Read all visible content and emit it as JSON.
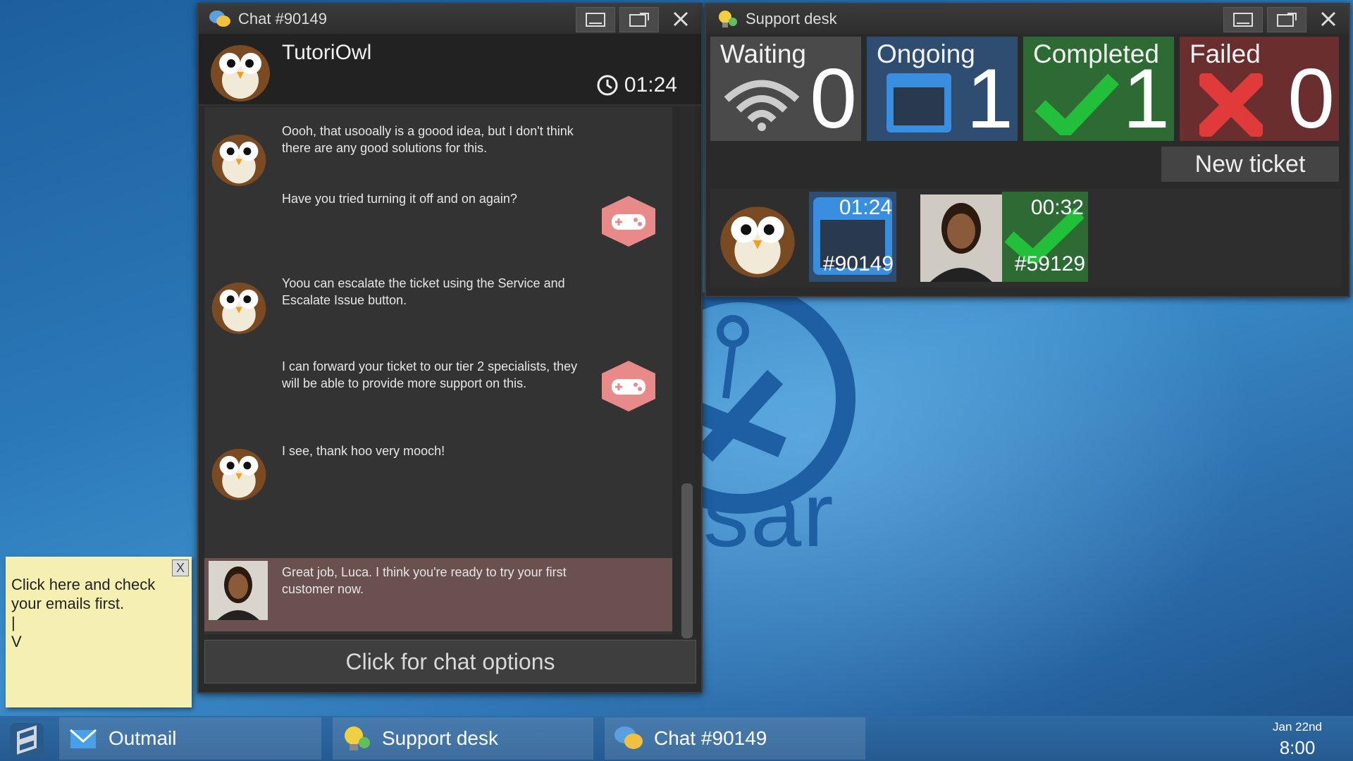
{
  "chat_window": {
    "title": "Chat #90149",
    "contact_name": "TutoriOwl",
    "timer": "01:24",
    "messages": [
      {
        "text": "Oooh, that usooally is a goood idea, but I don't think there are any good solutions for this."
      },
      {
        "text": "Have you tried turning it off and on again?"
      },
      {
        "text": "Yoou can escalate the ticket using the Service and Escalate Issue button."
      },
      {
        "text": "I can forward your ticket to our tier 2 specialists, they will be able to provide more support on this."
      },
      {
        "text": "I see, thank hoo very mooch!"
      },
      {
        "text": "Great job, Luca. I think you're ready to try your first customer now."
      }
    ],
    "options_label": "Click for chat options"
  },
  "support_desk": {
    "title": "Support desk",
    "stats": [
      {
        "label": "Waiting",
        "count": "0",
        "color": "#4a4a4a"
      },
      {
        "label": "Ongoing",
        "count": "1",
        "color": "#2e4d70"
      },
      {
        "label": "Completed",
        "count": "1",
        "color": "#2d6a34"
      },
      {
        "label": "Failed",
        "count": "0",
        "color": "#6a2e2e"
      }
    ],
    "new_ticket_label": "New ticket",
    "tickets": [
      {
        "time": "01:24",
        "id": "#90149"
      },
      {
        "time": "00:32",
        "id": "#59129"
      }
    ]
  },
  "sticky_note": {
    "text": "Click here and check\nyour emails first.\n|\nV",
    "close_label": "X"
  },
  "desktop": {
    "logo_text": "sar"
  },
  "taskbar": {
    "items": [
      {
        "label": "Outmail"
      },
      {
        "label": "Support desk"
      },
      {
        "label": "Chat #90149"
      }
    ],
    "date": "Jan 22nd",
    "time": "8:00"
  },
  "colors": {
    "highlight_message": "#6b5050",
    "agent_badge": "#e88a8a"
  }
}
